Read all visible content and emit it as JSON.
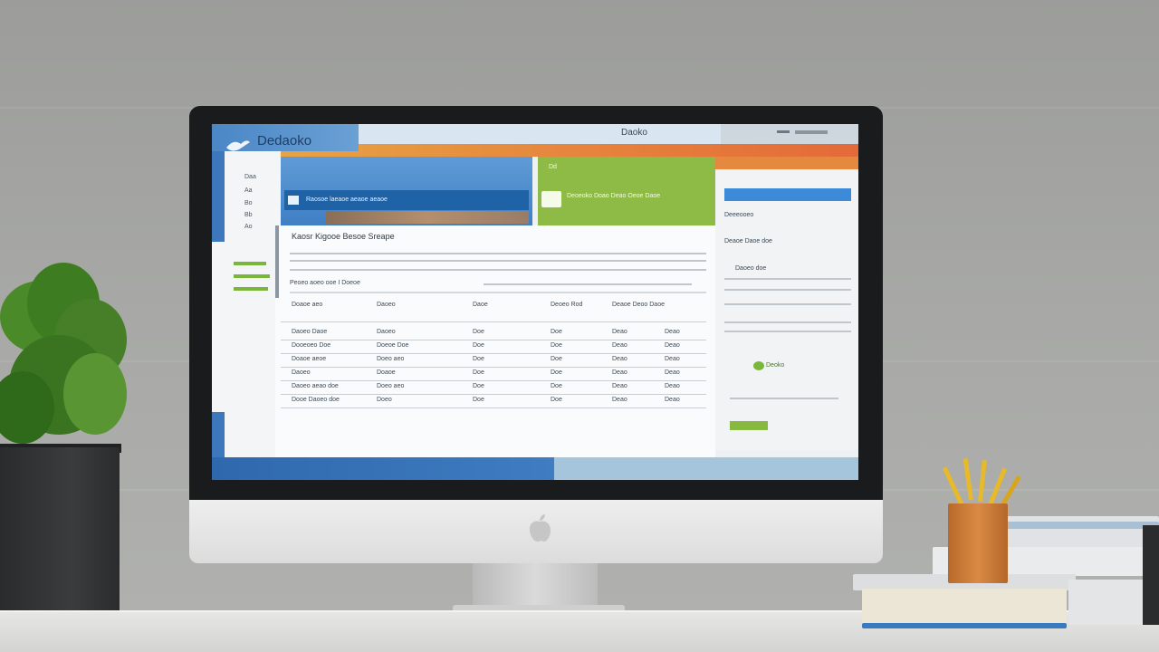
{
  "scene": "desk-monitor",
  "screen": {
    "brand_name": "Dedaoko",
    "window_title": "Daoko",
    "hero_heading": "Raosoe laeaoe aeaoe aeaoe",
    "hero_green_label": "Dd",
    "hero_green_text": "Deoeoko Doao Deao Oeoe Daoe",
    "main_heading": "Kaosr Kigooe Besoe Sreape",
    "sub_heading": "Peoeo aoeo ooe I Doeoe",
    "right_link": "Deoko",
    "sidebar_items": [
      "Daa",
      "Aa",
      "Bo",
      "Bb",
      "Ao"
    ],
    "table_headers": [
      "Doaoe aeo",
      "Daoeo",
      "Daoe",
      "Deoeo Rod",
      "Deaoe Deoo Daoe"
    ],
    "table_rows": [
      [
        "Daoeo Daoe",
        "Daoeo",
        "Doe",
        "Doe",
        "Deao",
        "Deao"
      ],
      [
        "Dooeoeo Doe",
        "Doeoe Doe",
        "Doe",
        "Doe",
        "Deao",
        "Deao"
      ],
      [
        "Doaoe aeoe",
        "Doeo aeo",
        "Doe",
        "Doe",
        "Deao",
        "Deao"
      ],
      [
        "Daoeo",
        "Doaoe",
        "Doe",
        "Doe",
        "Deao",
        "Deao"
      ],
      [
        "Daoeo aeao doe",
        "Doeo aeo",
        "Doe",
        "Doe",
        "Deao",
        "Deao"
      ],
      [
        "Dooe Daoeo doe",
        "Doeo",
        "Doe",
        "Doe",
        "Deao",
        "Deao"
      ]
    ],
    "right_panel_items": [
      "Deeeooeo",
      "Deaoe Daoe doe",
      "Daoeo doe"
    ]
  },
  "colors": {
    "wall": "#a3a4a1",
    "accent_blue": "#3d78bd",
    "accent_green": "#8dbb45",
    "accent_orange": "#e5893f"
  }
}
